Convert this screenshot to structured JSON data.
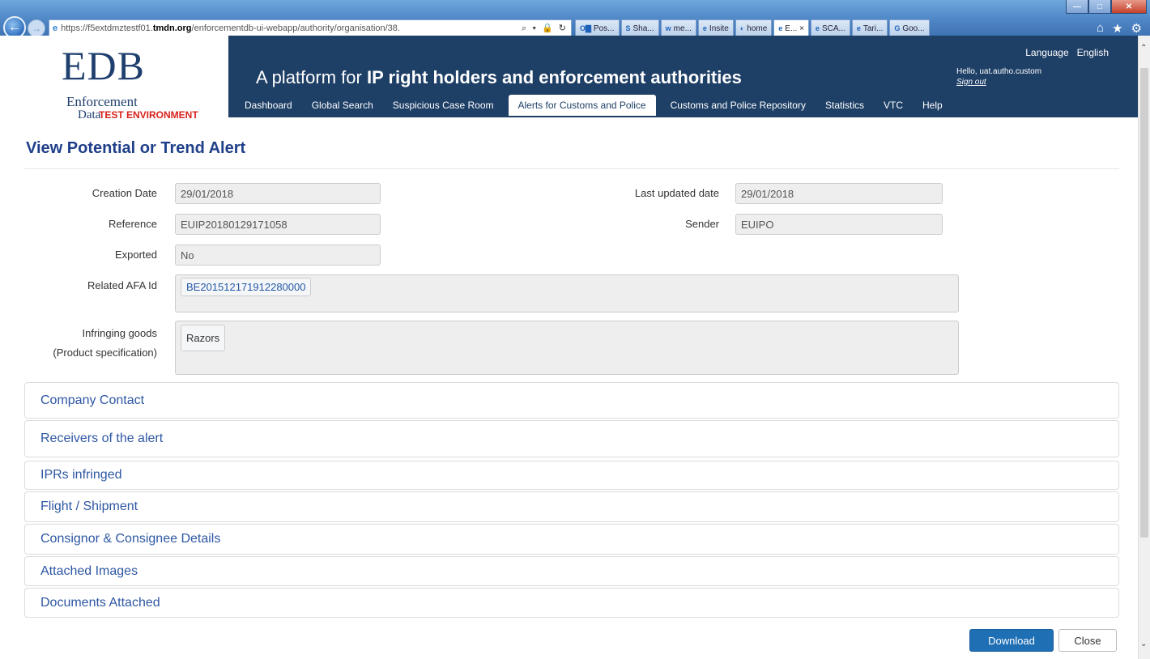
{
  "browser": {
    "url_prefix": "https://f5extdmztestf01.",
    "url_domain": "tmdn.org",
    "url_path": "/enforcementdb-ui-webapp/authority/organisation/38.",
    "address_tools": "⌕ ▾ 🔒 ↻",
    "tabs": [
      {
        "icon": "O▇",
        "label": "Pos..."
      },
      {
        "icon": "S",
        "label": "Sha..."
      },
      {
        "icon": "w",
        "label": "me..."
      },
      {
        "icon": "e",
        "label": "Insite"
      },
      {
        "icon": "◐",
        "label": "home"
      },
      {
        "icon": "e",
        "label": "E... ×"
      },
      {
        "icon": "e",
        "label": "SCA..."
      },
      {
        "icon": "e",
        "label": "Tari..."
      },
      {
        "icon": "G",
        "label": "Goo..."
      }
    ],
    "window_controls": {
      "minimize": "—",
      "maximize": "□",
      "close": "✕"
    }
  },
  "header": {
    "logo_big": "EDB",
    "logo_line1": "Enforcement",
    "logo_line2": "Data",
    "test_env": "TEST ENVIRONMENT",
    "tagline_pre": "A platform for ",
    "tagline_bold": "IP right holders and enforcement authorities",
    "language_label": "Language",
    "language_value": "English",
    "greeting": "Hello, uat.autho.custom",
    "sign_out": "Sign out",
    "nav": [
      "Dashboard",
      "Global Search",
      "Suspicious Case Room",
      "Alerts for Customs and Police",
      "Customs and Police Repository",
      "Statistics",
      "VTC",
      "Help"
    ]
  },
  "page": {
    "title": "View Potential or Trend Alert",
    "fields": {
      "creation_date_label": "Creation Date",
      "creation_date": "29/01/2018",
      "last_updated_label": "Last updated date",
      "last_updated": "29/01/2018",
      "reference_label": "Reference",
      "reference": "EUIP20180129171058",
      "sender_label": "Sender",
      "sender": "EUIPO",
      "exported_label": "Exported",
      "exported": "No",
      "related_afa_label": "Related AFA Id",
      "related_afa": "BE201512171912280000",
      "infringing_goods_label": "Infringing goods",
      "product_spec_label": "(Product specification)",
      "infringing_goods": "Razors"
    },
    "panels": [
      "Company Contact",
      "Receivers of the alert",
      "IPRs infringed",
      "Flight / Shipment",
      "Consignor & Consignee Details",
      "Attached Images",
      "Documents Attached"
    ],
    "buttons": {
      "download": "Download",
      "close": "Close"
    }
  }
}
